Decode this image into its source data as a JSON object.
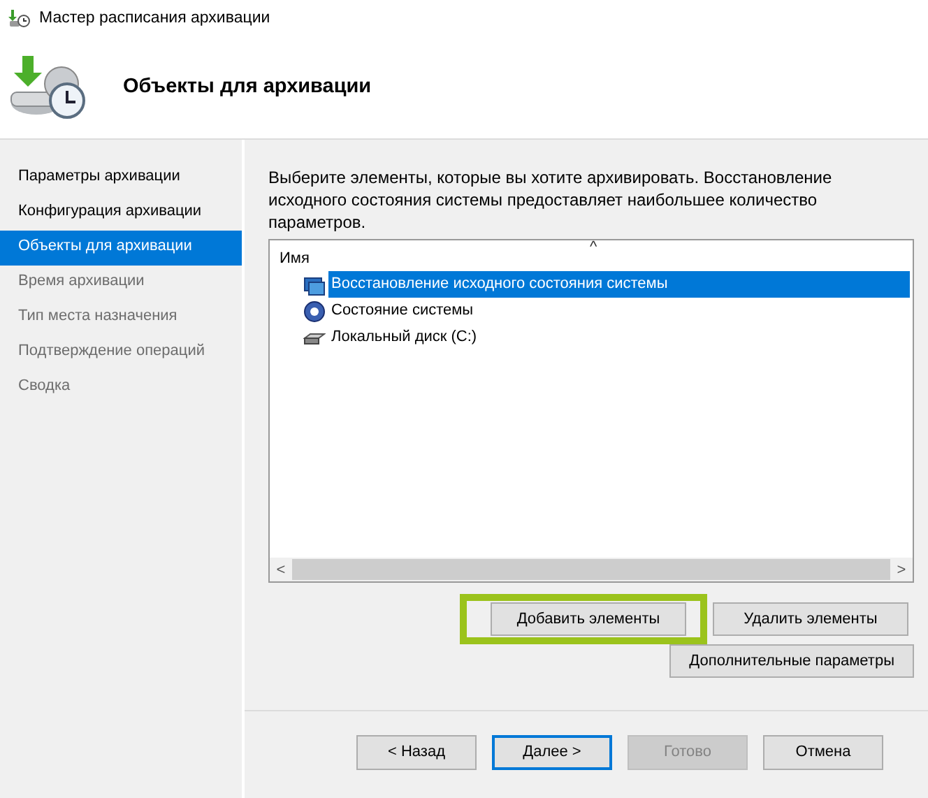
{
  "window": {
    "title": "Мастер расписания архивации"
  },
  "header": {
    "title": "Объекты для архивации"
  },
  "steps": [
    {
      "label": "Параметры архивации",
      "selected": false,
      "disabled": false
    },
    {
      "label": "Конфигурация архивации",
      "selected": false,
      "disabled": false
    },
    {
      "label": "Объекты для архивации",
      "selected": true,
      "disabled": false
    },
    {
      "label": "Время архивации",
      "selected": false,
      "disabled": true
    },
    {
      "label": "Тип места назначения",
      "selected": false,
      "disabled": true
    },
    {
      "label": "Подтверждение операций",
      "selected": false,
      "disabled": true
    },
    {
      "label": "Сводка",
      "selected": false,
      "disabled": true
    }
  ],
  "description": "Выберите элементы, которые вы хотите архивировать. Восстановление исходного состояния системы предоставляет наибольшее количество параметров.",
  "list": {
    "column": "Имя",
    "sort_glyph": "^",
    "items": [
      {
        "label": "Восстановление исходного состояния системы",
        "kind": "restore",
        "selected": true
      },
      {
        "label": "Состояние системы",
        "kind": "state",
        "selected": false
      },
      {
        "label": "Локальный диск (C:)",
        "kind": "disk",
        "selected": false
      }
    ],
    "scroll_left": "<",
    "scroll_right": ">"
  },
  "item_buttons": [
    {
      "label": "Добавить элементы",
      "highlighted": true
    },
    {
      "label": "Удалить элементы",
      "highlighted": false
    }
  ],
  "advanced_button": "Дополнительные параметры",
  "nav_buttons": [
    {
      "label": "< Назад",
      "default": false,
      "disabled": false
    },
    {
      "label": "Далее >",
      "default": true,
      "disabled": false
    },
    {
      "label": "Готово",
      "default": false,
      "disabled": true
    },
    {
      "label": "Отмена",
      "default": false,
      "disabled": false
    }
  ]
}
